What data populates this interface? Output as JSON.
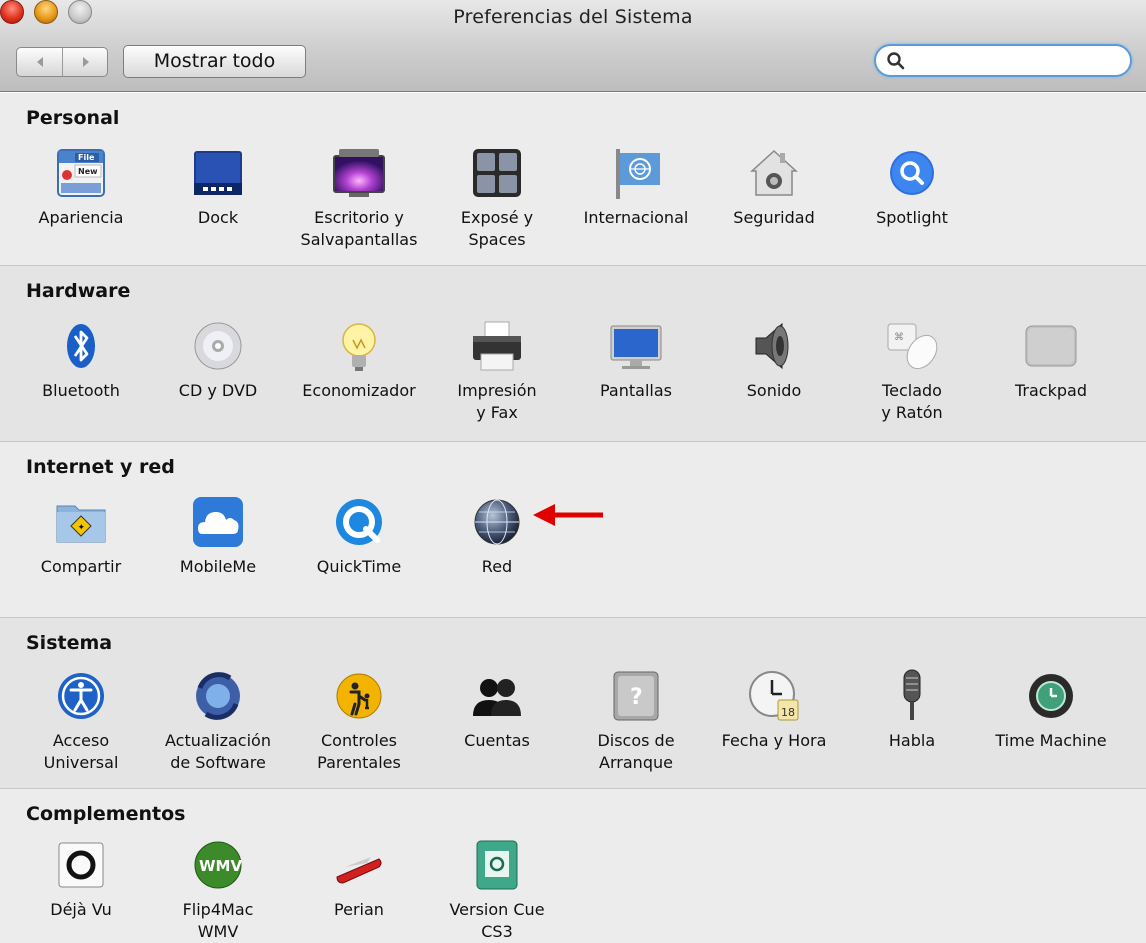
{
  "window": {
    "title": "Preferencias del Sistema"
  },
  "toolbar": {
    "show_all_label": "Mostrar todo",
    "search_value": "",
    "search_placeholder": ""
  },
  "sections": {
    "personal": {
      "title": "Personal",
      "items": [
        {
          "label": "Apariencia",
          "icon": "appearance-icon"
        },
        {
          "label": "Dock",
          "icon": "dock-icon"
        },
        {
          "label": "Escritorio y\nSalvapantallas",
          "icon": "desktop-screensaver-icon"
        },
        {
          "label": "Exposé y\nSpaces",
          "icon": "expose-spaces-icon"
        },
        {
          "label": "Internacional",
          "icon": "international-flag-icon"
        },
        {
          "label": "Seguridad",
          "icon": "security-house-icon"
        },
        {
          "label": "Spotlight",
          "icon": "spotlight-icon"
        }
      ]
    },
    "hardware": {
      "title": "Hardware",
      "items": [
        {
          "label": "Bluetooth",
          "icon": "bluetooth-icon"
        },
        {
          "label": "CD y DVD",
          "icon": "cd-dvd-icon"
        },
        {
          "label": "Economizador",
          "icon": "lightbulb-icon"
        },
        {
          "label": "Impresión\ny Fax",
          "icon": "printer-icon"
        },
        {
          "label": "Pantallas",
          "icon": "display-icon"
        },
        {
          "label": "Sonido",
          "icon": "speaker-icon"
        },
        {
          "label": "Teclado\ny Ratón",
          "icon": "keyboard-mouse-icon"
        },
        {
          "label": "Trackpad",
          "icon": "trackpad-icon"
        }
      ]
    },
    "internet": {
      "title": "Internet y red",
      "items": [
        {
          "label": "Compartir",
          "icon": "sharing-folder-icon"
        },
        {
          "label": "MobileMe",
          "icon": "mobileme-cloud-icon"
        },
        {
          "label": "QuickTime",
          "icon": "quicktime-icon"
        },
        {
          "label": "Red",
          "icon": "network-globe-icon"
        }
      ]
    },
    "sistema": {
      "title": "Sistema",
      "items": [
        {
          "label": "Acceso\nUniversal",
          "icon": "universal-access-icon"
        },
        {
          "label": "Actualización\nde Software",
          "icon": "software-update-icon"
        },
        {
          "label": "Controles\nParentales",
          "icon": "parental-controls-icon"
        },
        {
          "label": "Cuentas",
          "icon": "accounts-icon"
        },
        {
          "label": "Discos de\nArranque",
          "icon": "startup-disk-icon"
        },
        {
          "label": "Fecha y Hora",
          "icon": "date-time-clock-icon"
        },
        {
          "label": "Habla",
          "icon": "microphone-icon"
        },
        {
          "label": "Time Machine",
          "icon": "time-machine-icon"
        }
      ]
    },
    "complementos": {
      "title": "Complementos",
      "items": [
        {
          "label": "Déjà Vu",
          "icon": "deja-vu-icon"
        },
        {
          "label": "Flip4Mac\nWMV",
          "icon": "flip4mac-wmv-icon"
        },
        {
          "label": "Perian",
          "icon": "perian-knife-icon"
        },
        {
          "label": "Version Cue\nCS3",
          "icon": "version-cue-icon"
        }
      ]
    }
  },
  "colors": {
    "annotation_arrow": "#e00000",
    "search_focus": "#5c9bd9"
  }
}
